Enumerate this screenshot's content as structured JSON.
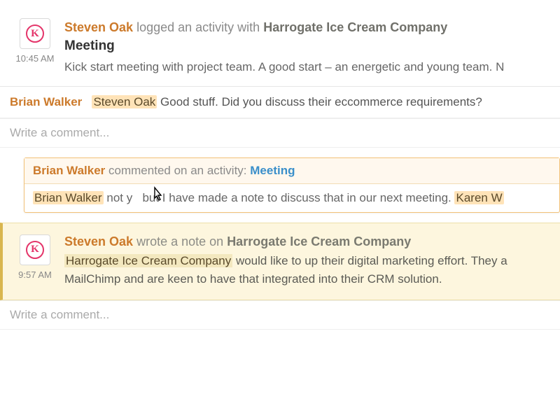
{
  "colors": {
    "accent_orange": "#cc7a2b",
    "accent_pink": "#e4356a",
    "link_blue": "#3a8fca",
    "note_bg": "#fdf6de"
  },
  "avatar_glyph": "K",
  "entries": [
    {
      "time": "10:45 AM",
      "actor": "Steven Oak",
      "verb": "logged an activity with",
      "target": "Harrogate Ice Cream Company",
      "subject": "Meeting",
      "desc": "Kick start meeting with project team. A good start – an energetic and young team. N"
    }
  ],
  "thread_comment": {
    "author": "Brian Walker",
    "mention": "Steven Oak",
    "text": " Good stuff. Did you discuss their eccommerce requirements?"
  },
  "comment_placeholder": "Write a comment...",
  "reply_card": {
    "author": "Brian Walker",
    "verb": "commented on an activity: ",
    "link": "Meeting",
    "body_author": "Brian Walker",
    "body_pre": " not y",
    "body_post": "but I have made a note to discuss that in our next meeting. ",
    "body_tail_mention": "Karen W"
  },
  "note_entry": {
    "time": "9:57 AM",
    "actor": "Steven Oak",
    "verb": "wrote a note on",
    "target": "Harrogate Ice Cream Company",
    "body_noun": "Harrogate Ice Cream Company",
    "body_text": " would like to up their digital marketing effort. They a",
    "body_line2": "MailChimp and are keen to have that integrated into their CRM solution."
  }
}
